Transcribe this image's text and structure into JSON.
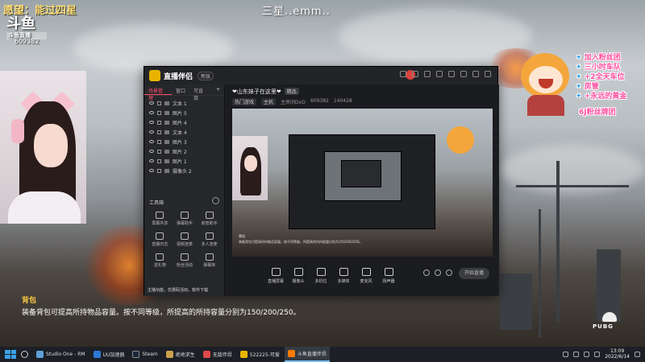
{
  "overlay": {
    "wish_text": "愿望：能过四星",
    "center_text": "三星..emm..",
    "platform_logo": "斗鱼",
    "platform_sub": "斗鱼直播",
    "room_id": "609382"
  },
  "bulletins": [
    "加入粉丝团",
    "三小时车队",
    "+2全天车位",
    "房管",
    "+永远的黄金",
    "6J粉丝牌团"
  ],
  "app": {
    "name": "直播伴侣",
    "version_badge": "新版",
    "room_title": "❤山东妹子在这里❤",
    "room_badge": "精品",
    "meta": {
      "category": "热门游戏",
      "sub": "主机",
      "room_label": "主房间DxO",
      "room_no": "609382",
      "fans": "140428"
    },
    "sidebar_tabs": [
      "场景管理",
      "窗口",
      "可直接"
    ],
    "sidebar_add": "+",
    "scenes": [
      "文本 1",
      "图片 5",
      "图片 4",
      "文本 4",
      "图片 3",
      "图片 2",
      "图片 1",
      "摄像头 2"
    ],
    "tools_head": "工具箱",
    "tools": [
      "屏幕共享",
      "弹幕助手",
      "房管助手",
      "直播日志",
      "视频连麦",
      "多人连麦",
      "送礼物",
      "粉丝活动",
      "弹幕库",
      "直播设置",
      "工具",
      "更多"
    ],
    "sidebar_footer": "主播功能，优惠码活动，软件下载",
    "controls": [
      "直播屏幕",
      "摄像头",
      "多机位",
      "多媒体",
      "麦克风",
      "扬声器"
    ],
    "golive": "开始直播",
    "preview_caption": "装备背包可提高所持物品容量。按不同等级，所提高的所持容量分别为150/200/250。",
    "preview_subcaption": "背包"
  },
  "item": {
    "title": "背包",
    "desc": "装备背包可提高所持物品容量。按不同等级，所提高的所持容量分别为150/200/250。"
  },
  "taskbar": {
    "tasks": [
      {
        "label": "Studio One - RM",
        "color": "#5fa0d8"
      },
      {
        "label": "UU加速器",
        "color": "#2f78d6"
      },
      {
        "label": "Steam",
        "color": "#1b2838"
      },
      {
        "label": "绝地求生",
        "color": "#c9a24a"
      },
      {
        "label": "无敌伴侣",
        "color": "#e04848"
      },
      {
        "label": "522225-可爱",
        "color": "#e8b400"
      },
      {
        "label": "斗鱼直播伴侣",
        "color": "#ff7a00"
      }
    ],
    "time": "13:09",
    "date": "2022/6/14"
  },
  "pubg_text": "PUBG"
}
